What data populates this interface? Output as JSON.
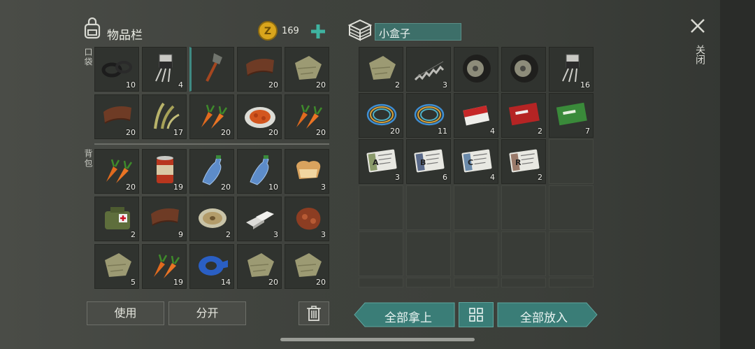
{
  "inventory": {
    "title": "物品栏",
    "coins": "169",
    "pocket_label": "口袋",
    "backpack_label": "背包",
    "items": [
      {
        "icon": "rubber-rings-icon",
        "count": "10"
      },
      {
        "icon": "transistor-icon",
        "count": "4"
      },
      {
        "icon": "shovel-icon",
        "count": ""
      },
      {
        "icon": "leather-icon",
        "count": "20"
      },
      {
        "icon": "cloth-icon",
        "count": "20"
      },
      {
        "icon": "leather-icon",
        "count": "20"
      },
      {
        "icon": "plant-fiber-icon",
        "count": "17"
      },
      {
        "icon": "carrot-icon",
        "count": "20"
      },
      {
        "icon": "stew-plate-icon",
        "count": "20"
      },
      {
        "icon": "carrot-icon",
        "count": "20"
      },
      {
        "icon": "carrot-icon",
        "count": "20"
      },
      {
        "icon": "canned-food-icon",
        "count": "19"
      },
      {
        "icon": "water-bottle-icon",
        "count": "20"
      },
      {
        "icon": "water-bottle-icon",
        "count": "10"
      },
      {
        "icon": "toast-icon",
        "count": "3"
      },
      {
        "icon": "medkit-bag-icon",
        "count": "2"
      },
      {
        "icon": "leather-icon",
        "count": "9"
      },
      {
        "icon": "thread-spool-icon",
        "count": "2"
      },
      {
        "icon": "metal-bars-icon",
        "count": "3"
      },
      {
        "icon": "meat-icon",
        "count": "3"
      },
      {
        "icon": "cloth-icon",
        "count": "5"
      },
      {
        "icon": "carrot-icon",
        "count": "19"
      },
      {
        "icon": "duct-tape-icon",
        "count": "14"
      },
      {
        "icon": "cloth-icon",
        "count": "20"
      },
      {
        "icon": "cloth-icon",
        "count": "20"
      }
    ],
    "use_label": "使用",
    "split_label": "分开"
  },
  "container": {
    "title": "小盒子",
    "items": [
      {
        "icon": "cloth-icon",
        "count": "2"
      },
      {
        "icon": "spring-icon",
        "count": "3"
      },
      {
        "icon": "tire-icon",
        "count": ""
      },
      {
        "icon": "tire-icon",
        "count": ""
      },
      {
        "icon": "transistor-icon",
        "count": "16"
      },
      {
        "icon": "wires-icon",
        "count": "20"
      },
      {
        "icon": "wires-icon",
        "count": "11"
      },
      {
        "icon": "cigarettes-icon",
        "count": "4"
      },
      {
        "icon": "combat-gear-coupon-icon",
        "count": "2"
      },
      {
        "icon": "ration-coupon-icon",
        "count": "7"
      },
      {
        "icon": "army-card-a-icon",
        "count": "3",
        "letter": "A"
      },
      {
        "icon": "army-card-b-icon",
        "count": "6",
        "letter": "B"
      },
      {
        "icon": "army-card-c-icon",
        "count": "4",
        "letter": "C"
      },
      {
        "icon": "army-card-r-icon",
        "count": "2",
        "letter": "R"
      }
    ],
    "take_all_label": "全部拿上",
    "put_all_label": "全部放入"
  },
  "close_label": "关闭",
  "colors": {
    "accent": "#3f8a83",
    "coin": "#d9a51c",
    "plus": "#3fb3a0",
    "name_box": "#3d6f69"
  }
}
